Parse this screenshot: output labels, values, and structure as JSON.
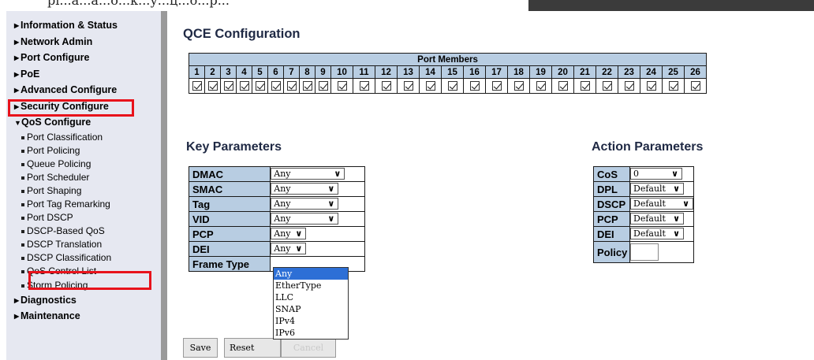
{
  "top_fragment": "рі...а...а...о...к...у...ц...о...р...",
  "sidebar": {
    "items": [
      {
        "label": "Information & Status"
      },
      {
        "label": "Network Admin"
      },
      {
        "label": "Port Configure"
      },
      {
        "label": "PoE"
      },
      {
        "label": "Advanced Configure"
      },
      {
        "label": "Security Configure"
      },
      {
        "label": "QoS Configure"
      },
      {
        "label": "Diagnostics"
      },
      {
        "label": "Maintenance"
      }
    ],
    "qos_subitems": [
      {
        "label": "Port Classification"
      },
      {
        "label": "Port Policing"
      },
      {
        "label": "Queue Policing"
      },
      {
        "label": "Port Scheduler"
      },
      {
        "label": "Port Shaping"
      },
      {
        "label": "Port Tag Remarking"
      },
      {
        "label": "Port DSCP"
      },
      {
        "label": "DSCP-Based QoS"
      },
      {
        "label": "DSCP Translation"
      },
      {
        "label": "DSCP Classification"
      },
      {
        "label": "QoS Control List"
      },
      {
        "label": "Storm Policing"
      }
    ]
  },
  "main": {
    "title": "QCE Configuration",
    "port_members": {
      "header": "Port Members",
      "ports": [
        "1",
        "2",
        "3",
        "4",
        "5",
        "6",
        "7",
        "8",
        "9",
        "10",
        "11",
        "12",
        "13",
        "14",
        "15",
        "16",
        "17",
        "18",
        "19",
        "20",
        "21",
        "22",
        "23",
        "24",
        "25",
        "26"
      ],
      "checked": [
        true,
        true,
        true,
        true,
        true,
        true,
        true,
        true,
        true,
        true,
        true,
        true,
        true,
        true,
        true,
        true,
        true,
        true,
        true,
        true,
        true,
        true,
        true,
        true,
        true,
        true
      ]
    },
    "key_parameters": {
      "title": "Key Parameters",
      "rows": [
        {
          "label": "DMAC",
          "value": "Any"
        },
        {
          "label": "SMAC",
          "value": "Any"
        },
        {
          "label": "Tag",
          "value": "Any"
        },
        {
          "label": "VID",
          "value": "Any"
        },
        {
          "label": "PCP",
          "value": "Any"
        },
        {
          "label": "DEI",
          "value": "Any"
        },
        {
          "label": "Frame Type",
          "value": "Any"
        }
      ]
    },
    "frame_type_dropdown": {
      "options": [
        "Any",
        "EtherType",
        "LLC",
        "SNAP",
        "IPv4",
        "IPv6"
      ],
      "selected": "Any"
    },
    "action_parameters": {
      "title": "Action Parameters",
      "rows": [
        {
          "label": "CoS",
          "value": "0"
        },
        {
          "label": "DPL",
          "value": "Default"
        },
        {
          "label": "DSCP",
          "value": "Default"
        },
        {
          "label": "PCP",
          "value": "Default"
        },
        {
          "label": "DEI",
          "value": "Default"
        },
        {
          "label": "Policy",
          "value": ""
        }
      ]
    },
    "buttons": {
      "save": "Save",
      "reset": "Reset",
      "cancel": "Cancel"
    }
  },
  "colors": {
    "sidebar_bg": "#e6e8f1",
    "table_header": "#b8cde2",
    "highlight_box": "#e8121b",
    "dropdown_selected": "#2d6fd6",
    "title": "#1f2944"
  }
}
